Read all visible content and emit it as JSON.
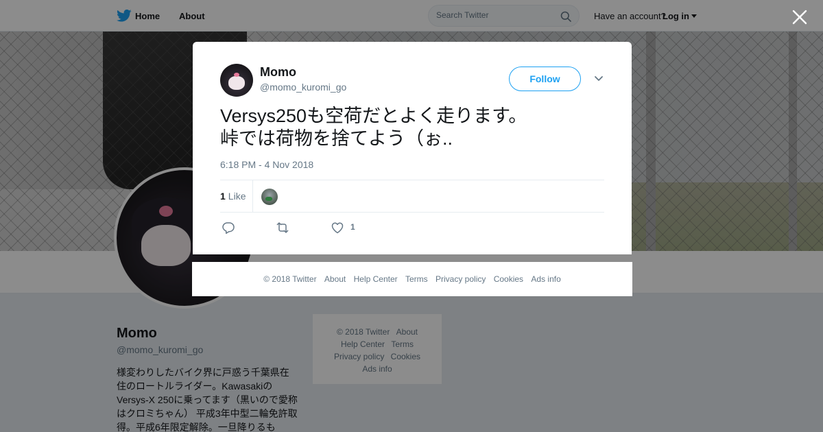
{
  "nav": {
    "home_label": "Home",
    "about_label": "About",
    "search_placeholder": "Search Twitter",
    "have_account": "Have an account?",
    "login_label": "Log in"
  },
  "profile": {
    "name": "Momo",
    "handle": "@momo_kuromi_go",
    "bio": "様変わりしたバイク界に戸惑う千葉県在住のロートルライダー。KawasakiのVersys-X 250に乗ってます（黒いので愛称はクロミちゃん） 平成3年中型二輪免許取得。平成6年限定解除。一旦降りるも"
  },
  "side_footer": {
    "copyright": "© 2018 Twitter",
    "about": "About",
    "help": "Help Center",
    "terms": "Terms",
    "privacy": "Privacy policy",
    "cookies": "Cookies",
    "ads": "Ads info"
  },
  "tweet": {
    "name": "Momo",
    "handle": "@momo_kuromi_go",
    "follow_label": "Follow",
    "text": "Versys250も空荷だとよく走ります。\n峠では荷物を捨てよう（ぉ..",
    "timestamp": "6:18 PM - 4 Nov 2018",
    "likes_count": "1",
    "likes_label": "Like",
    "action_like_count": "1"
  },
  "modal_footer": {
    "copyright": "© 2018 Twitter",
    "about": "About",
    "help": "Help Center",
    "terms": "Terms",
    "privacy": "Privacy policy",
    "cookies": "Cookies",
    "ads": "Ads info"
  },
  "icons": {
    "logo": "twitter-bird-icon",
    "search": "search-icon",
    "close": "close-icon",
    "caret": "chevron-down-icon",
    "reply": "reply-icon",
    "retweet": "retweet-icon",
    "like": "heart-icon"
  },
  "colors": {
    "brand": "#1da1f2",
    "text": "#14171a",
    "secondary": "#657786"
  }
}
